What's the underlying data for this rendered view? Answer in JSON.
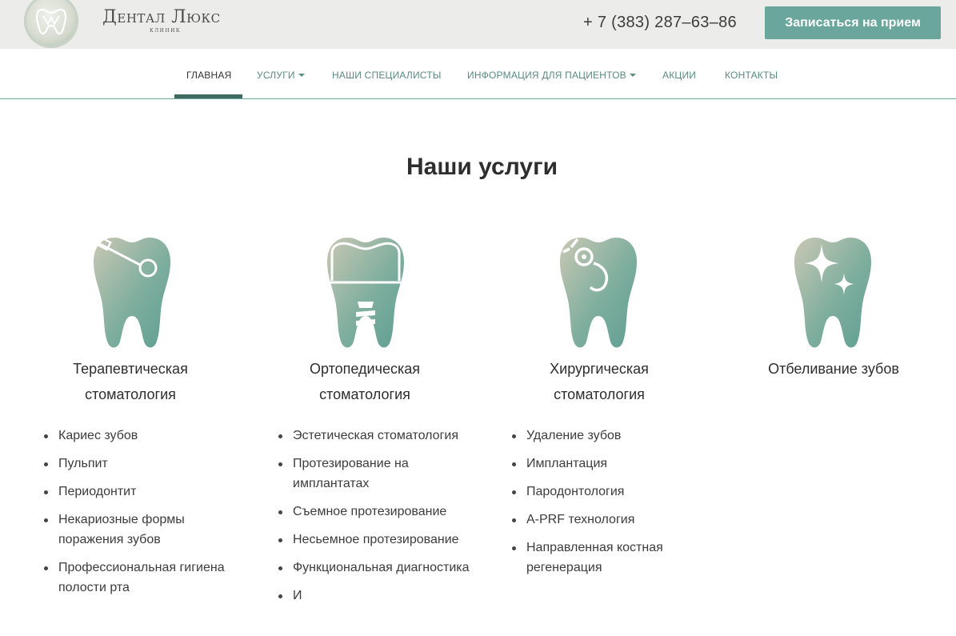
{
  "header": {
    "brand_name": "Дентал Люкс",
    "brand_sub": "клиник",
    "phone": "+ 7 (383) 287–63–86",
    "cta_label": "Записаться на прием",
    "logo_icon": "tooth-logo-icon"
  },
  "nav": {
    "items": [
      {
        "label": "Главная",
        "active": true
      },
      {
        "label": "Услуги",
        "dropdown": true
      },
      {
        "label": "Наши специалисты"
      },
      {
        "label": "Информация для пациентов",
        "dropdown": true
      },
      {
        "label": "Акции"
      },
      {
        "label": "Контакты"
      }
    ]
  },
  "section": {
    "title": "Наши услуги"
  },
  "services": [
    {
      "title_line1": "Терапевтическая",
      "title_line2": "стоматология",
      "icon": "tooth-mirror-icon",
      "items": [
        "Кариес зубов",
        "Пульпит",
        "Периодонтит",
        "Некариозные формы поражения зубов",
        "Профессиональная гигиена полости рта"
      ]
    },
    {
      "title_line1": "Ортопедическая",
      "title_line2": "стоматология",
      "icon": "tooth-implant-icon",
      "items": [
        "Эстетическая стоматология",
        "Протезирование на имплантатах",
        "Съемное протезирование",
        "Несьемное протезирование",
        "Функциональная диагностика",
        "И"
      ]
    },
    {
      "title_line1": "Хирургическая",
      "title_line2": "стоматология",
      "icon": "tooth-probe-icon",
      "items": [
        "Удаление зубов",
        "Имплантация",
        "Пародонтология",
        "A-PRF технология",
        "Направленная костная регенерация"
      ]
    },
    {
      "title_line1": "Отбеливание зубов",
      "title_line2": "",
      "icon": "tooth-sparkle-icon",
      "items": []
    }
  ],
  "colors": {
    "accent": "#6aa69b",
    "nav_text": "#5a8a82",
    "underline": "#3e6a62",
    "topbar": "#ececea"
  }
}
